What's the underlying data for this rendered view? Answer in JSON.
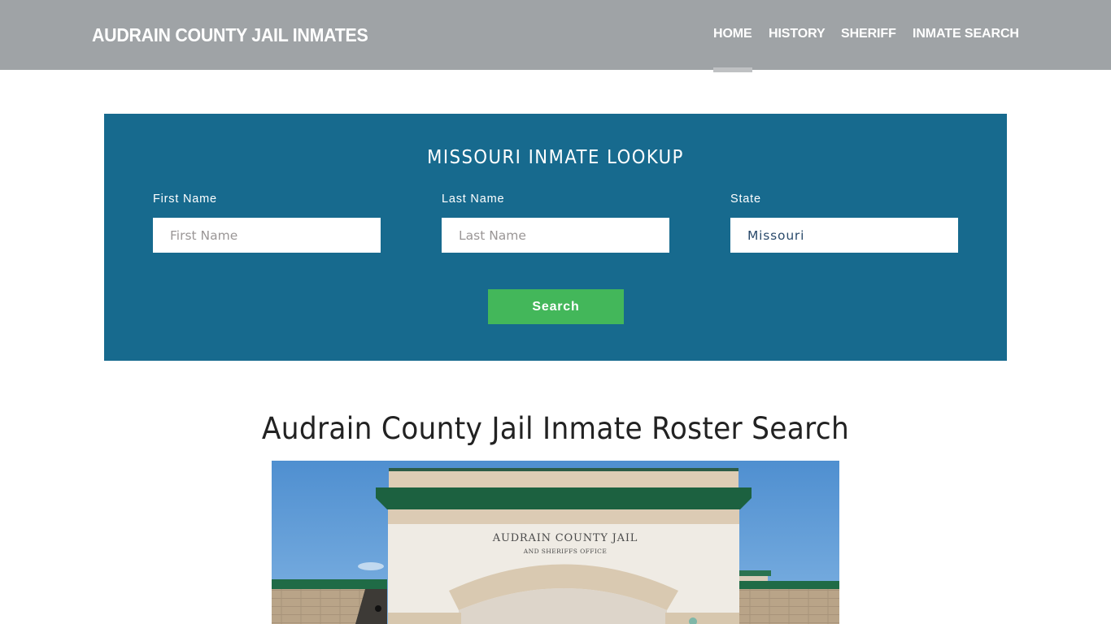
{
  "header": {
    "brand": "AUDRAIN COUNTY JAIL INMATES",
    "nav": [
      {
        "label": "HOME",
        "active": true
      },
      {
        "label": "HISTORY",
        "active": false
      },
      {
        "label": "SHERIFF",
        "active": false
      },
      {
        "label": "INMATE SEARCH",
        "active": false
      }
    ]
  },
  "lookup": {
    "title": "MISSOURI INMATE LOOKUP",
    "fields": [
      {
        "label": "First Name",
        "placeholder": "First Name",
        "value": ""
      },
      {
        "label": "Last Name",
        "placeholder": "Last Name",
        "value": ""
      },
      {
        "label": "State",
        "placeholder": "",
        "value": "Missouri"
      }
    ],
    "search_label": "Search"
  },
  "main": {
    "title": "Audrain County Jail Inmate Roster Search",
    "photo": {
      "alt": "Audrain County Jail building facade",
      "sign_line1": "AUDRAIN COUNTY JAIL",
      "sign_line2": "AND SHERIFFS OFFICE"
    }
  },
  "colors": {
    "header_bg": "#9fa3a6",
    "panel_bg": "#176a8e",
    "button_bg": "#43b75a"
  }
}
